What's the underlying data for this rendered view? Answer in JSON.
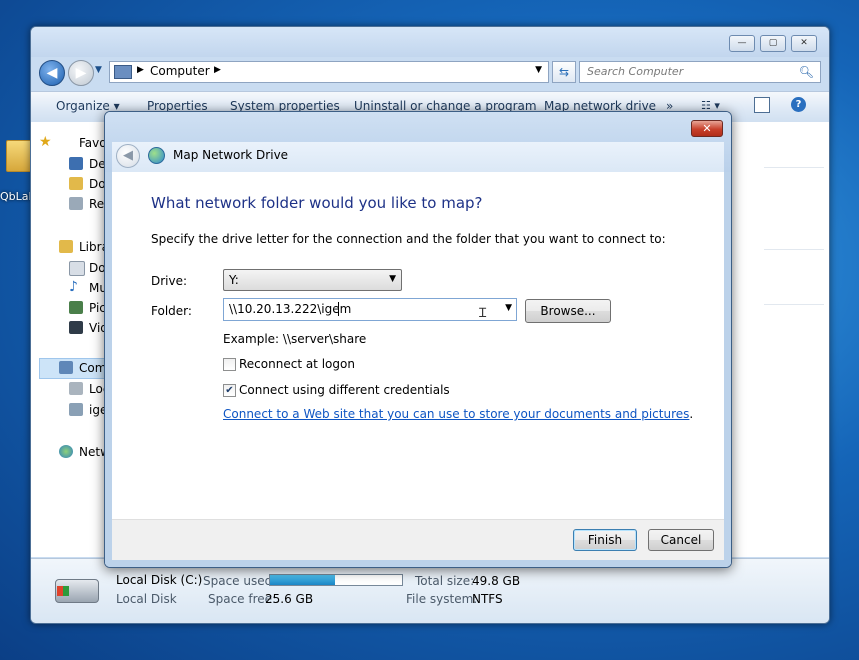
{
  "desktop": {
    "icon_label": "QbLab"
  },
  "explorer": {
    "caption": {
      "minimize": "—",
      "maximize": "▢",
      "close": "✕"
    },
    "address": {
      "segments": [
        "Computer"
      ]
    },
    "search": {
      "placeholder": "Search Computer"
    },
    "toolbar": [
      "Organize ▾",
      "Properties",
      "System properties",
      "Uninstall or change a program",
      "Map network drive",
      "»"
    ],
    "nav_pane": [
      {
        "label": "Favo",
        "icon": "star-icon"
      },
      {
        "label": "De",
        "icon": "desktop-icon"
      },
      {
        "label": "Do",
        "icon": "downloads-icon"
      },
      {
        "label": "Re",
        "icon": "recent-places-icon"
      },
      {
        "label": "Libra",
        "icon": "libraries-icon"
      },
      {
        "label": "Do",
        "icon": "documents-icon"
      },
      {
        "label": "Mu",
        "icon": "music-icon"
      },
      {
        "label": "Pic",
        "icon": "pictures-icon"
      },
      {
        "label": "Vid",
        "icon": "videos-icon"
      },
      {
        "label": "Com",
        "icon": "computer-icon"
      },
      {
        "label": "Loc",
        "icon": "local-disk-icon"
      },
      {
        "label": "ige",
        "icon": "network-drive-icon"
      },
      {
        "label": "Netw",
        "icon": "network-icon"
      }
    ],
    "details": {
      "name": "Local Disk (C:)",
      "type": "Local Disk",
      "space_used_label": "Space used:",
      "space_used_fraction": 0.49,
      "space_free_label": "Space free:",
      "space_free": "25.6 GB",
      "total_size_label": "Total size:",
      "total_size": "49.8 GB",
      "filesystem_label": "File system:",
      "filesystem": "NTFS"
    }
  },
  "dialog": {
    "title": "Map Network Drive",
    "close": "✕",
    "heading": "What network folder would you like to map?",
    "instructions": "Specify the drive letter for the connection and the folder that you want to connect to:",
    "drive_label": "Drive:",
    "drive_value": "Y:",
    "folder_label": "Folder:",
    "folder_value": "\\\\10.20.13.222\\igem",
    "browse_label": "Browse...",
    "example": "Example: \\\\server\\share",
    "reconnect_label": "Reconnect at logon",
    "reconnect_checked": false,
    "credentials_label": "Connect using different credentials",
    "credentials_checked": true,
    "link_text": "Connect to a Web site that you can use to store your documents and pictures",
    "link_suffix": ".",
    "finish_label": "Finish",
    "cancel_label": "Cancel"
  }
}
